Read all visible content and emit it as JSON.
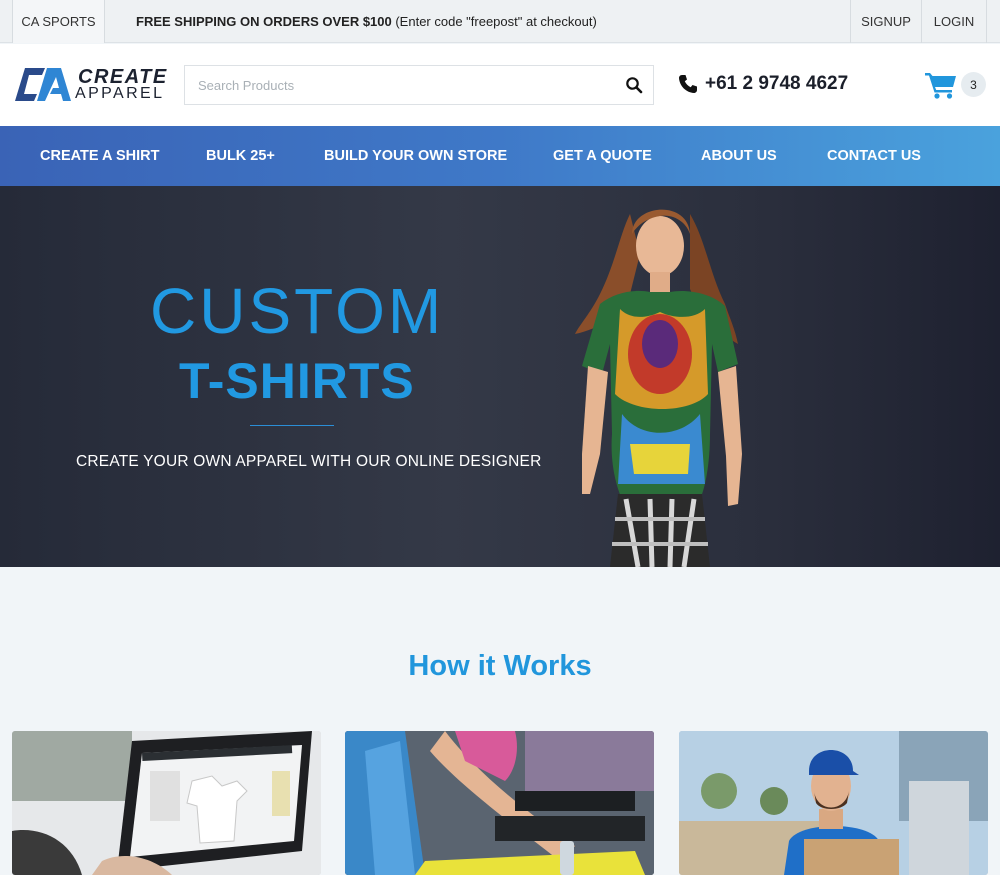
{
  "topbar": {
    "ca_sports": "CA SPORTS",
    "shipping_bold": "FREE SHIPPING ON ORDERS OVER $100",
    "shipping_rest": " (Enter code \"freepost\" at checkout)",
    "signup": "SIGNUP",
    "login": "LOGIN"
  },
  "header": {
    "logo_line1": "CREATE",
    "logo_line2": "APPAREL",
    "search_placeholder": "Search Products",
    "phone": "+61 2 9748 4627",
    "cart_count": "3"
  },
  "nav": {
    "items": [
      {
        "label": "CREATE A SHIRT"
      },
      {
        "label": "BULK 25+"
      },
      {
        "label": "BUILD YOUR OWN STORE"
      },
      {
        "label": "GET A QUOTE"
      },
      {
        "label": "ABOUT US"
      },
      {
        "label": "CONTACT US"
      }
    ]
  },
  "hero": {
    "line1": "CUSTOM",
    "line2": "T-SHIRTS",
    "subtitle": "CREATE YOUR OWN APPAREL WITH OUR ONLINE DESIGNER"
  },
  "how": {
    "title": "How it Works"
  },
  "colors": {
    "accent": "#2199e2",
    "nav_start": "#3a63b6",
    "nav_end": "#4aa2dd",
    "hero_bg": "#2f3442"
  },
  "icons": {
    "search": "search-icon",
    "phone": "phone-icon",
    "cart": "cart-icon"
  }
}
